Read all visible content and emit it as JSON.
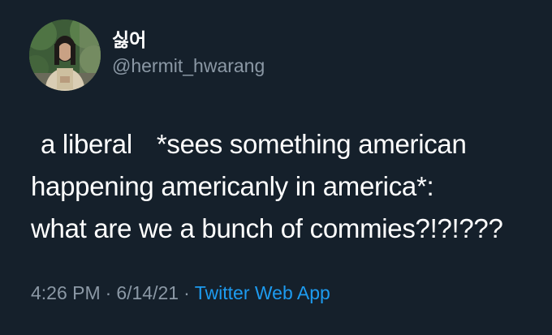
{
  "author": {
    "display_name": "싫어",
    "handle": "@hermit_hwarang"
  },
  "tweet": {
    "part1": "a liberal",
    "part2": "*sees something american",
    "line2": "happening americanly in america*:",
    "part3": "what are we a bunch of",
    "part4": "commies?!?!???"
  },
  "meta": {
    "time": "4:26 PM",
    "separator": "·",
    "date": "6/14/21",
    "source": "Twitter Web App"
  },
  "colors": {
    "background": "#15202b",
    "text": "#ffffff",
    "muted": "#8b98a5",
    "link": "#1d9bf0"
  }
}
